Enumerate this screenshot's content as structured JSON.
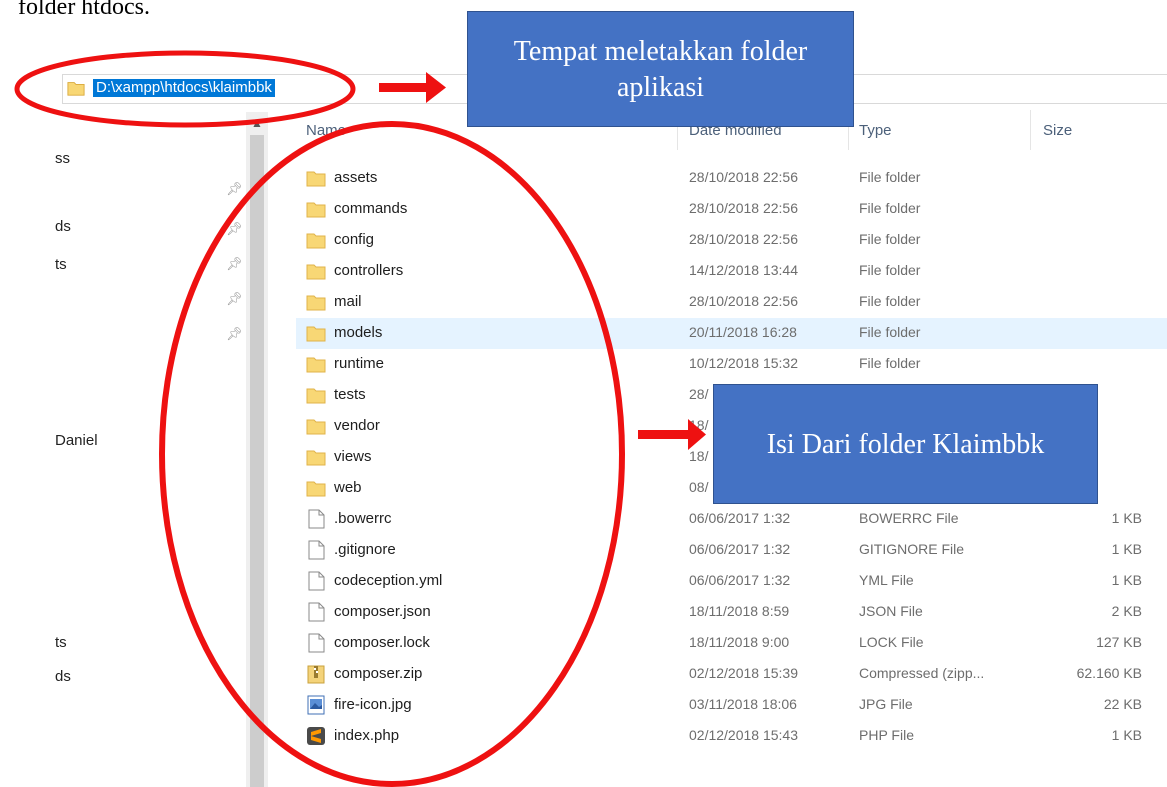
{
  "heading": "folder htdocs.",
  "address": {
    "path": "D:\\xampp\\htdocs\\klaimbbk"
  },
  "nav": {
    "items": [
      "ss",
      "ds",
      "ts",
      "Daniel",
      "ts",
      "ds"
    ]
  },
  "columns": {
    "name": "Name",
    "date": "Date modified",
    "type": "Type",
    "size": "Size"
  },
  "files": [
    {
      "name": "assets",
      "date": "28/10/2018 22:56",
      "type": "File folder",
      "size": "",
      "icon": "folder-icon"
    },
    {
      "name": "commands",
      "date": "28/10/2018 22:56",
      "type": "File folder",
      "size": "",
      "icon": "folder-icon"
    },
    {
      "name": "config",
      "date": "28/10/2018 22:56",
      "type": "File folder",
      "size": "",
      "icon": "folder-icon"
    },
    {
      "name": "controllers",
      "date": "14/12/2018 13:44",
      "type": "File folder",
      "size": "",
      "icon": "folder-icon"
    },
    {
      "name": "mail",
      "date": "28/10/2018 22:56",
      "type": "File folder",
      "size": "",
      "icon": "folder-icon"
    },
    {
      "name": "models",
      "date": "20/11/2018 16:28",
      "type": "File folder",
      "size": "",
      "icon": "folder-icon",
      "selected": true
    },
    {
      "name": "runtime",
      "date": "10/12/2018 15:32",
      "type": "File folder",
      "size": "",
      "icon": "folder-icon"
    },
    {
      "name": "tests",
      "date": "28/",
      "type": "",
      "size": "",
      "icon": "folder-icon"
    },
    {
      "name": "vendor",
      "date": "18/",
      "type": "",
      "size": "",
      "icon": "folder-icon"
    },
    {
      "name": "views",
      "date": "18/",
      "type": "",
      "size": "",
      "icon": "folder-icon"
    },
    {
      "name": "web",
      "date": "08/",
      "type": "",
      "size": "",
      "icon": "folder-icon"
    },
    {
      "name": ".bowerrc",
      "date": "06/06/2017 1:32",
      "type": "BOWERRC File",
      "size": "1 KB",
      "icon": "file-icon"
    },
    {
      "name": ".gitignore",
      "date": "06/06/2017 1:32",
      "type": "GITIGNORE File",
      "size": "1 KB",
      "icon": "file-icon"
    },
    {
      "name": "codeception.yml",
      "date": "06/06/2017 1:32",
      "type": "YML File",
      "size": "1 KB",
      "icon": "file-icon"
    },
    {
      "name": "composer.json",
      "date": "18/11/2018 8:59",
      "type": "JSON File",
      "size": "2 KB",
      "icon": "file-icon"
    },
    {
      "name": "composer.lock",
      "date": "18/11/2018 9:00",
      "type": "LOCK File",
      "size": "127 KB",
      "icon": "file-icon"
    },
    {
      "name": "composer.zip",
      "date": "02/12/2018 15:39",
      "type": "Compressed (zipp...",
      "size": "62.160 KB",
      "icon": "zip-icon"
    },
    {
      "name": "fire-icon.jpg",
      "date": "03/11/2018 18:06",
      "type": "JPG File",
      "size": "22 KB",
      "icon": "image-icon"
    },
    {
      "name": "index.php",
      "date": "02/12/2018 15:43",
      "type": "PHP File",
      "size": "1 KB",
      "icon": "sublime-icon"
    }
  ],
  "callouts": {
    "top": "Tempat meletakkan folder aplikasi",
    "middle": "Isi Dari folder Klaimbbk"
  },
  "colors": {
    "annotation_red": "#ee1111",
    "callout_blue": "#4472c4",
    "selection_blue": "#0078d7",
    "folder_yellow": "#f8d775"
  }
}
